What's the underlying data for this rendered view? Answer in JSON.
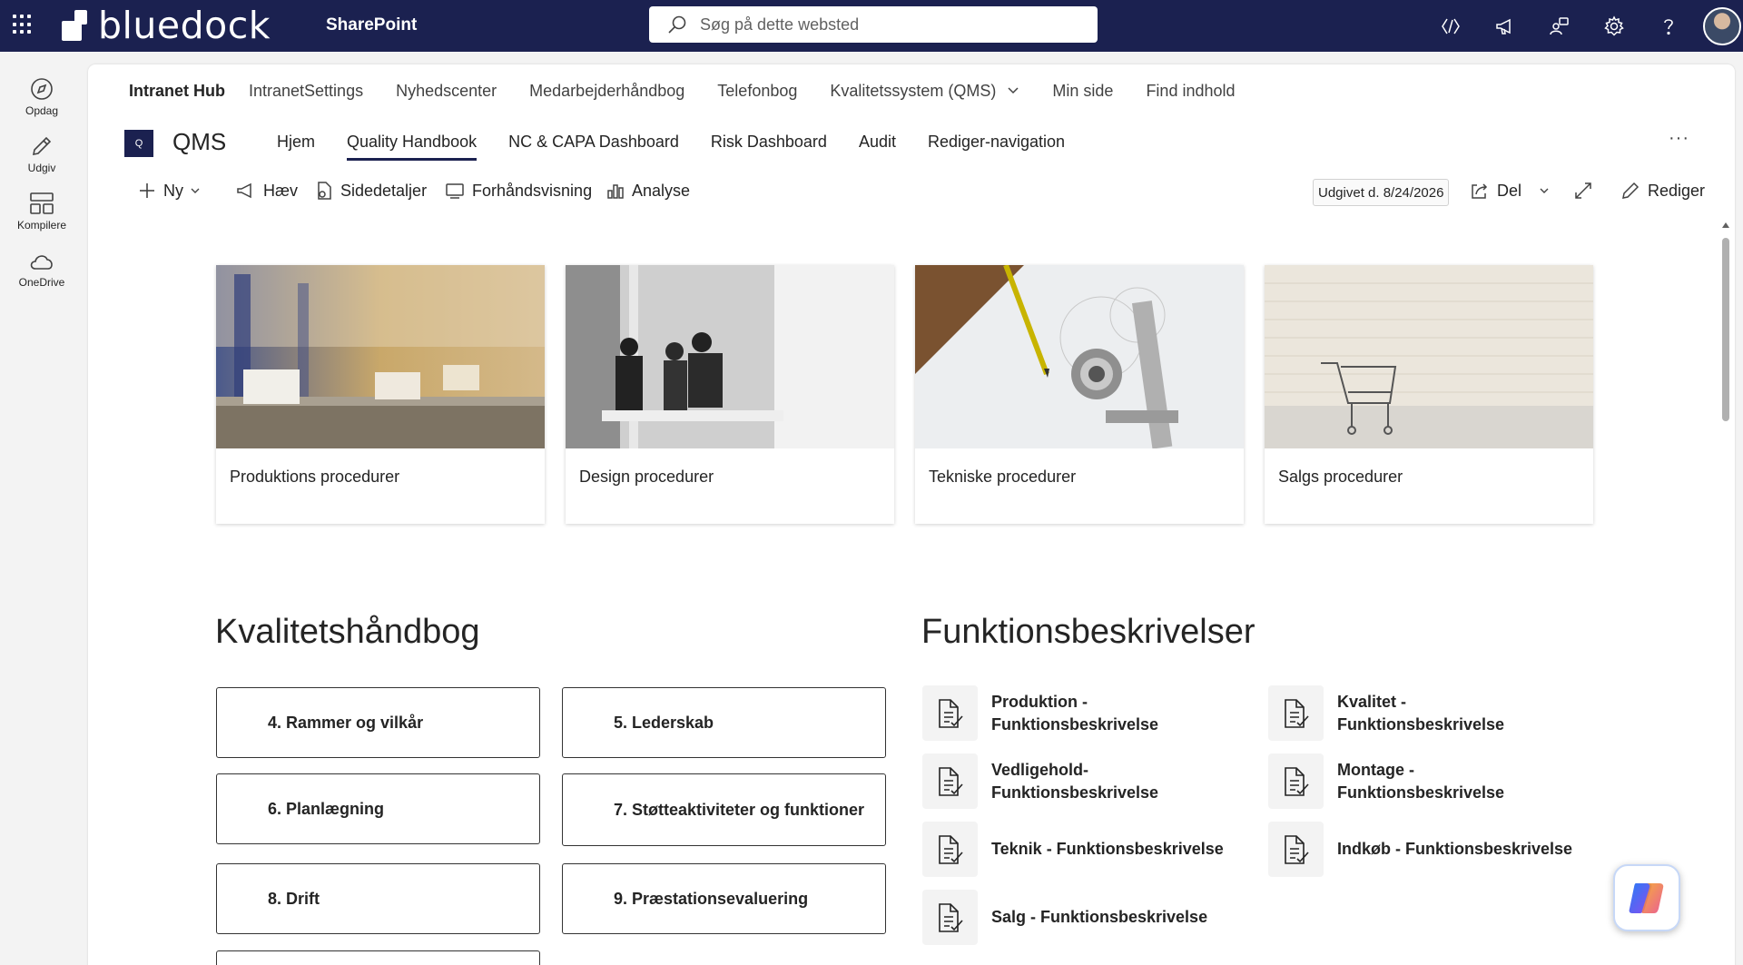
{
  "suitebar": {
    "brand": "bluedock",
    "app_name": "SharePoint",
    "search_placeholder": "Søg på dette websted",
    "icons": [
      "code-icon",
      "megaphone-icon",
      "share-people-icon",
      "gear-icon",
      "help-icon"
    ]
  },
  "rail": {
    "items": [
      {
        "label": "Opdag",
        "icon": "compass-icon"
      },
      {
        "label": "Udgiv",
        "icon": "pen-icon"
      },
      {
        "label": "Kompilere",
        "icon": "layout-icon"
      },
      {
        "label": "OneDrive",
        "icon": "cloud-icon"
      }
    ]
  },
  "hubnav": {
    "title": "Intranet Hub",
    "links": [
      "IntranetSettings",
      "Nyhedscenter",
      "Medarbejderhåndbog",
      "Telefonbog",
      "Kvalitetssystem (QMS)",
      "Min side",
      "Find indhold"
    ]
  },
  "site": {
    "logo_letter": "Q",
    "title": "QMS",
    "nav": [
      "Hjem",
      "Quality Handbook",
      "NC & CAPA Dashboard",
      "Risk Dashboard",
      "Audit",
      "Rediger-navigation"
    ],
    "active_nav": "Quality Handbook",
    "more": "···"
  },
  "cmdbar": {
    "new": "Ny",
    "promote": "Hæv",
    "details": "Sidedetaljer",
    "preview": "Forhåndsvisning",
    "analytics": "Analyse",
    "published": "Udgivet d. 8/24/2026",
    "share": "Del",
    "edit": "Rediger"
  },
  "cards": [
    {
      "title": "Produktions procedurer"
    },
    {
      "title": "Design procedurer"
    },
    {
      "title": "Tekniske procedurer"
    },
    {
      "title": "Salgs procedurer"
    }
  ],
  "handbook": {
    "heading": "Kvalitetshåndbog",
    "buttons": [
      "4. Rammer og vilkår",
      "5. Lederskab",
      "6. Planlægning",
      "7. Støtteaktiviteter og funktioner",
      "8. Drift",
      "9. Præstationsevaluering"
    ]
  },
  "functions": {
    "heading": "Funktionsbeskrivelser",
    "items": [
      "Produktion - Funktionsbeskrivelse",
      "Kvalitet - Funktionsbeskrivelse",
      "Vedligehold-Funktionsbeskrivelse",
      "Montage - Funktionsbeskrivelse",
      "Teknik - Funktionsbeskrivelse",
      "Indkøb - Funktionsbeskrivelse",
      "Salg - Funktionsbeskrivelse"
    ]
  },
  "colors": {
    "suitebar": "#1b2150",
    "accent": "#1b2150"
  }
}
